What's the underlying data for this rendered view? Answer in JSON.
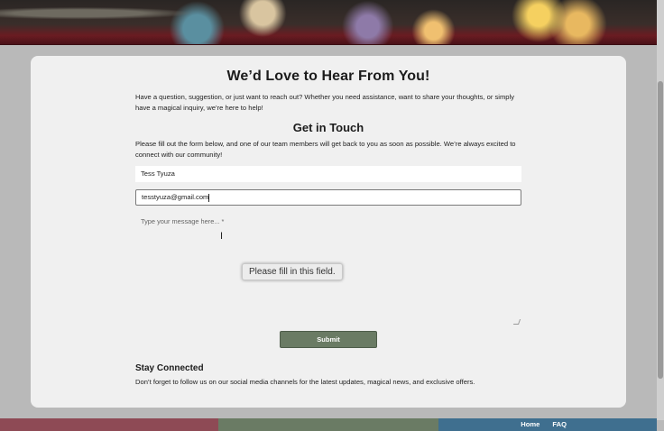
{
  "page": {
    "title": "We’d Love to Hear From You!",
    "intro": "Have a question, suggestion, or just want to reach out? Whether you need assistance, want to share your thoughts, or simply have a magical inquiry, we’re here to help!",
    "section_title": "Get in Touch",
    "fill_note": "Please fill out the form below, and one of our team members will get back to you as soon as possible. We’re always excited to connect with our community!"
  },
  "form": {
    "name_value": "Tess Tyuza",
    "email_value": "tesstyuza@gmail.com",
    "message_placeholder": "Type your message here... *",
    "validation_tooltip": "Please fill in this field.",
    "submit_label": "Submit"
  },
  "social": {
    "title": "Stay Connected",
    "note": "Don’t forget to follow us on our social media channels for the latest updates, magical news, and exclusive offers."
  },
  "footer": {
    "links": [
      "Home",
      "FAQ"
    ],
    "colors": [
      "#8e4a55",
      "#6a7b64",
      "#3f6f8f"
    ]
  },
  "icons": [
    "text-cursor-icon",
    "resize-grip-icon"
  ]
}
